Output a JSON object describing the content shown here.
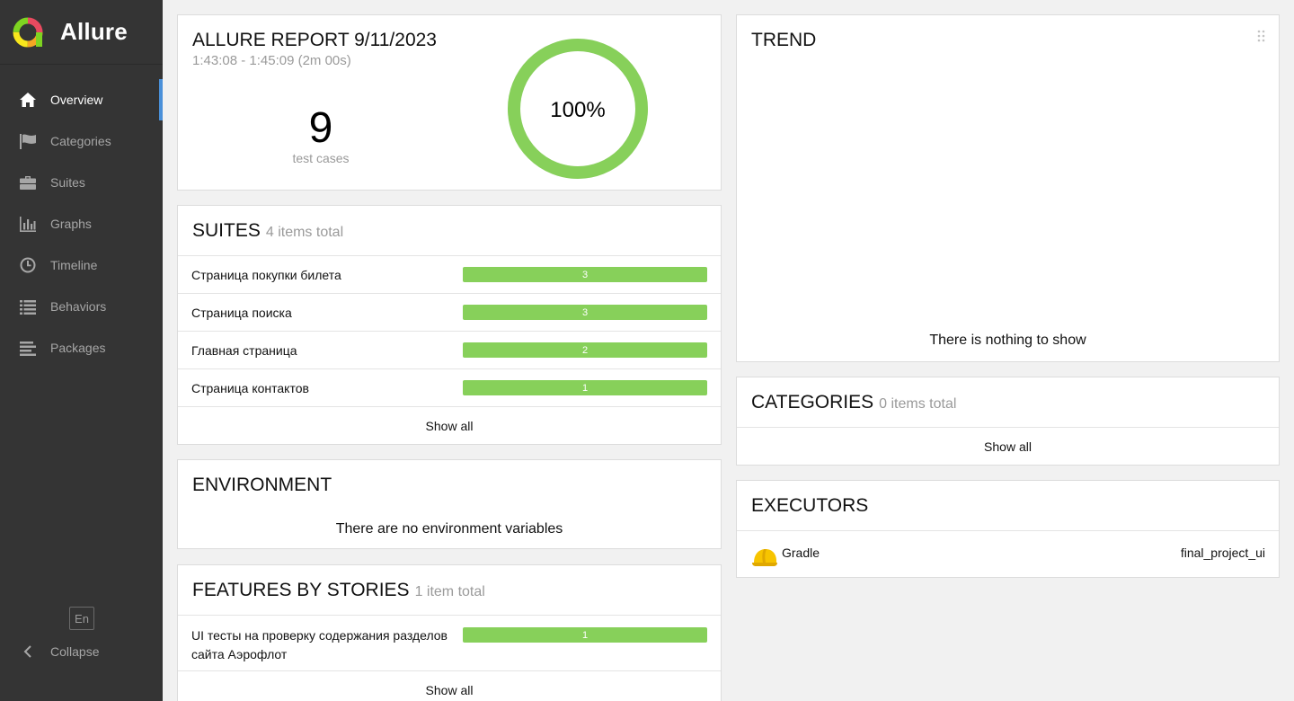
{
  "app": {
    "name": "Allure"
  },
  "sidebar": {
    "items": [
      {
        "label": "Overview",
        "icon": "home-icon",
        "active": true
      },
      {
        "label": "Categories",
        "icon": "flag-icon",
        "active": false
      },
      {
        "label": "Suites",
        "icon": "briefcase-icon",
        "active": false
      },
      {
        "label": "Graphs",
        "icon": "bar-chart-icon",
        "active": false
      },
      {
        "label": "Timeline",
        "icon": "clock-icon",
        "active": false
      },
      {
        "label": "Behaviors",
        "icon": "list-icon",
        "active": false
      },
      {
        "label": "Packages",
        "icon": "align-left-icon",
        "active": false
      }
    ],
    "language": "En",
    "collapse_label": "Collapse"
  },
  "summary": {
    "title": "ALLURE REPORT 9/11/2023",
    "time_range": "1:43:08 - 1:45:09 (2m 00s)",
    "test_count": "9",
    "test_count_label": "test cases",
    "pass_rate": 1.0,
    "pass_rate_label": "100%"
  },
  "suites": {
    "title": "SUITES",
    "subtitle": "4 items total",
    "items": [
      {
        "name": "Страница покупки билета",
        "count": "3"
      },
      {
        "name": "Страница поиска",
        "count": "3"
      },
      {
        "name": "Главная страница",
        "count": "2"
      },
      {
        "name": "Страница контактов",
        "count": "1"
      }
    ],
    "show_all": "Show all"
  },
  "environment": {
    "title": "ENVIRONMENT",
    "empty_text": "There are no environment variables"
  },
  "features": {
    "title": "FEATURES BY STORIES",
    "subtitle": "1 item total",
    "items": [
      {
        "name": "UI тесты на проверку содержания разделов сайта Аэрофлот",
        "count": "1"
      }
    ],
    "show_all": "Show all"
  },
  "trend": {
    "title": "TREND",
    "empty_text": "There is nothing to show"
  },
  "categories": {
    "title": "CATEGORIES",
    "subtitle": "0 items total",
    "show_all": "Show all"
  },
  "executors": {
    "title": "EXECUTORS",
    "name": "Gradle",
    "build": "final_project_ui",
    "icon": "hard-hat-icon"
  },
  "colors": {
    "sidebar_bg": "#343434",
    "accent": "#4a90d9",
    "passed": "#87d05a"
  }
}
